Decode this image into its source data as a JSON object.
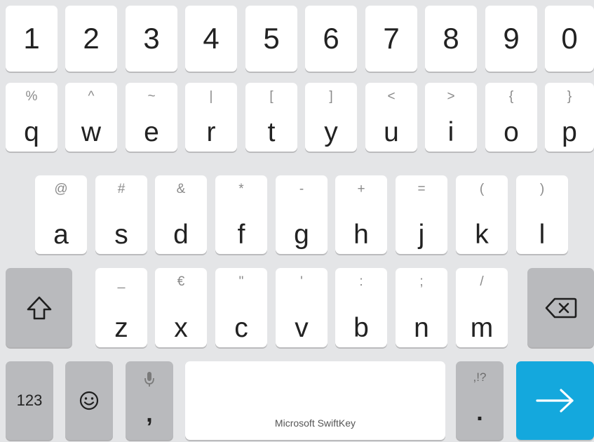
{
  "keyboard": {
    "brand": "Microsoft SwiftKey",
    "accent_color": "#14a8dd",
    "row_numbers": [
      {
        "main": "1"
      },
      {
        "main": "2"
      },
      {
        "main": "3"
      },
      {
        "main": "4"
      },
      {
        "main": "5"
      },
      {
        "main": "6"
      },
      {
        "main": "7"
      },
      {
        "main": "8"
      },
      {
        "main": "9"
      },
      {
        "main": "0"
      }
    ],
    "row_top": [
      {
        "main": "q",
        "sub": "%"
      },
      {
        "main": "w",
        "sub": "^"
      },
      {
        "main": "e",
        "sub": "~"
      },
      {
        "main": "r",
        "sub": "|"
      },
      {
        "main": "t",
        "sub": "["
      },
      {
        "main": "y",
        "sub": "]"
      },
      {
        "main": "u",
        "sub": "<"
      },
      {
        "main": "i",
        "sub": ">"
      },
      {
        "main": "o",
        "sub": "{"
      },
      {
        "main": "p",
        "sub": "}"
      }
    ],
    "row_home": [
      {
        "main": "a",
        "sub": "@"
      },
      {
        "main": "s",
        "sub": "#"
      },
      {
        "main": "d",
        "sub": "&"
      },
      {
        "main": "f",
        "sub": "*"
      },
      {
        "main": "g",
        "sub": "-"
      },
      {
        "main": "h",
        "sub": "+"
      },
      {
        "main": "j",
        "sub": "="
      },
      {
        "main": "k",
        "sub": "("
      },
      {
        "main": "l",
        "sub": ")"
      }
    ],
    "row_bottom": [
      {
        "main": "z",
        "sub": "_"
      },
      {
        "main": "x",
        "sub": "€"
      },
      {
        "main": "c",
        "sub": "\""
      },
      {
        "main": "v",
        "sub": "'"
      },
      {
        "main": "b",
        "sub": ":"
      },
      {
        "main": "n",
        "sub": ";"
      },
      {
        "main": "m",
        "sub": "/"
      }
    ],
    "function_keys": {
      "shift_icon": "shift-arrow-icon",
      "backspace_icon": "backspace-icon",
      "numbers_label": "123",
      "emoji_icon": "smiley-icon",
      "mic_icon": "microphone-icon",
      "comma_main": ",",
      "punct_sub": ",!?",
      "period_main": ".",
      "enter_icon": "arrow-right-icon"
    }
  }
}
